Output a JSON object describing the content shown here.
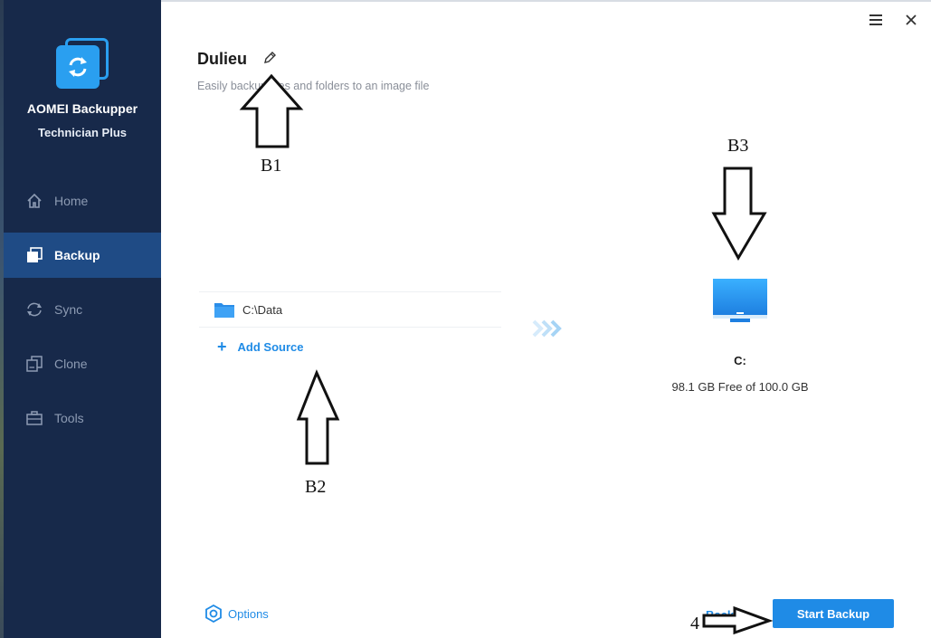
{
  "app": {
    "name": "AOMEI Backupper",
    "edition": "Technician Plus"
  },
  "sidebar": {
    "items": [
      {
        "label": "Home",
        "icon": "home-icon",
        "active": false
      },
      {
        "label": "Backup",
        "icon": "backup-icon",
        "active": true
      },
      {
        "label": "Sync",
        "icon": "sync-icon",
        "active": false
      },
      {
        "label": "Clone",
        "icon": "clone-icon",
        "active": false
      },
      {
        "label": "Tools",
        "icon": "tools-icon",
        "active": false
      }
    ]
  },
  "task": {
    "title": "Dulieu",
    "subtitle": "Easily backup files and folders to an image file"
  },
  "source": {
    "items": [
      "C:\\Data"
    ],
    "add_label": "Add Source"
  },
  "destination": {
    "label": "C:",
    "space": "98.1 GB Free of 100.0 GB"
  },
  "footer": {
    "options_label": "Options",
    "back_label": "Back",
    "start_label": "Start Backup"
  },
  "annotations": {
    "b1": "B1",
    "b2": "B2",
    "b3": "B3",
    "n4": "4"
  },
  "colors": {
    "sidebar_bg": "#17294a",
    "sidebar_active": "#1f4b85",
    "accent": "#1f8be6"
  }
}
